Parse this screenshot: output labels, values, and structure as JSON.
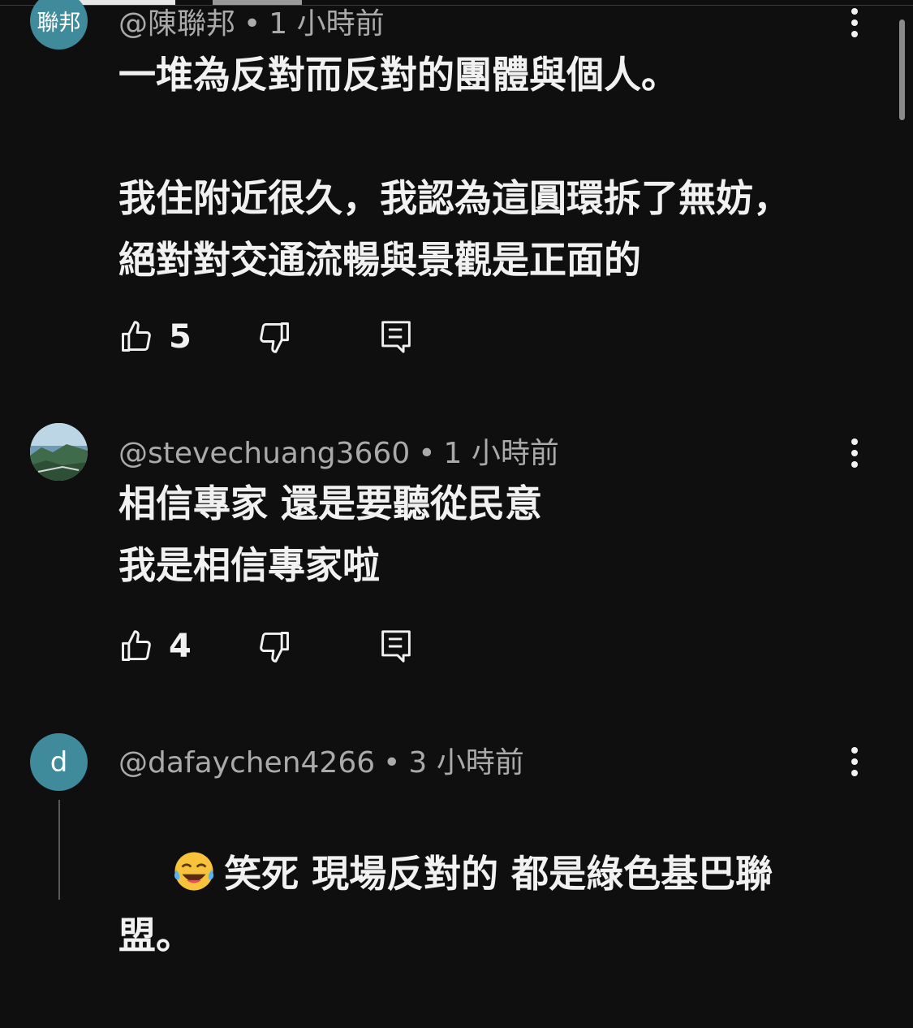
{
  "comments": [
    {
      "avatar_text": "聯邦",
      "handle": "@陳聯邦",
      "separator": "•",
      "time": "1 小時前",
      "body": "一堆為反對而反對的團體與個人。\n\n我住附近很久，我認為這圓環拆了無妨，絕對對交通流暢與景觀是正面的",
      "likes": "5"
    },
    {
      "avatar_text": "",
      "handle": "@stevechuang3660",
      "separator": "•",
      "time": "1 小時前",
      "body": "相信專家 還是要聽從民意\n我是相信專家啦",
      "likes": "4"
    },
    {
      "avatar_text": "d",
      "handle": "@dafaychen4266",
      "separator": "•",
      "time": "3 小時前",
      "emoji": "face-with-tears-of-joy",
      "body": "笑死 現場反對的 都是綠色基巴聯盟。",
      "likes": ""
    }
  ],
  "icons": {
    "like": "thumbs-up-icon",
    "dislike": "thumbs-down-icon",
    "reply": "reply-icon",
    "more": "more-vertical-icon"
  },
  "colors": {
    "background": "#0f0f0f",
    "text": "#f1f1f1",
    "meta": "#aaaaaa",
    "avatar": "#3f8a9b"
  }
}
